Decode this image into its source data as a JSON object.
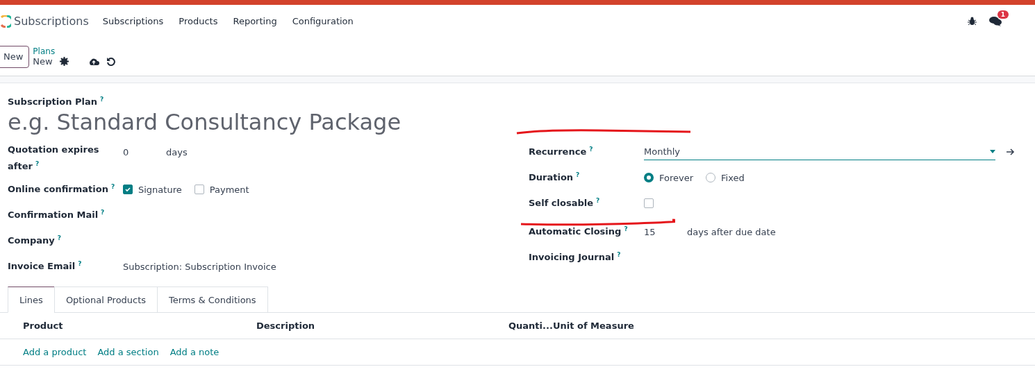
{
  "navbar": {
    "app_name": "Subscriptions",
    "menu": [
      {
        "label": "Subscriptions"
      },
      {
        "label": "Products"
      },
      {
        "label": "Reporting"
      },
      {
        "label": "Configuration"
      }
    ],
    "message_count": "1"
  },
  "control_panel": {
    "new_button": "New",
    "breadcrumb": "Plans",
    "record": "New"
  },
  "form": {
    "title_label": "Subscription Plan",
    "title_help": "?",
    "title_placeholder": "e.g. Standard Consultancy Package",
    "left": [
      {
        "kind": "number",
        "label": "Quotation expires after",
        "help": "?",
        "value": "0",
        "unit": "days"
      },
      {
        "kind": "checks",
        "label": "Online confirmation",
        "help": "?",
        "options": [
          {
            "label": "Signature",
            "checked": true
          },
          {
            "label": "Payment",
            "checked": false
          }
        ]
      },
      {
        "kind": "empty",
        "label": "Confirmation Mail",
        "help": "?"
      },
      {
        "kind": "empty",
        "label": "Company",
        "help": "?"
      },
      {
        "kind": "text",
        "label": "Invoice Email",
        "help": "?",
        "value": "Subscription: Subscription Invoice"
      }
    ],
    "right": [
      {
        "kind": "select",
        "label": "Recurrence",
        "help": "?",
        "value": "Monthly"
      },
      {
        "kind": "radio",
        "label": "Duration",
        "help": "?",
        "options": [
          {
            "label": "Forever",
            "selected": true
          },
          {
            "label": "Fixed",
            "selected": false
          }
        ]
      },
      {
        "kind": "check",
        "label": "Self closable",
        "help": "?",
        "checked": false
      },
      {
        "kind": "number",
        "label": "Automatic Closing",
        "help": "?",
        "value": "15",
        "unit": "days after due date"
      },
      {
        "kind": "empty",
        "label": "Invoicing Journal",
        "help": "?"
      }
    ]
  },
  "tabs": [
    {
      "label": "Lines",
      "selected": true
    },
    {
      "label": "Optional Products",
      "selected": false
    },
    {
      "label": "Terms & Conditions",
      "selected": false
    }
  ],
  "table": {
    "columns": [
      "Product",
      "Description",
      "Quanti...",
      "Unit of Measure"
    ],
    "add_links": [
      "Add a product",
      "Add a section",
      "Add a note"
    ]
  }
}
